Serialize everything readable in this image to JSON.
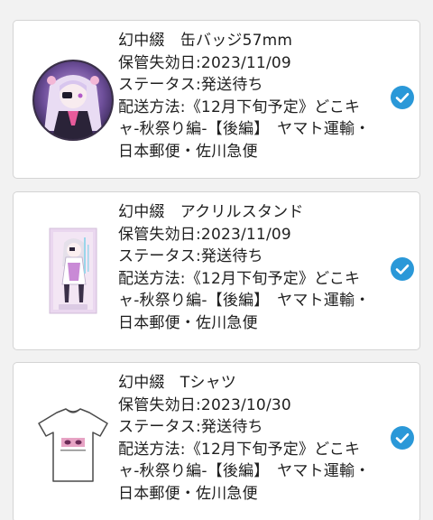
{
  "items": [
    {
      "name": "幻中綴　缶バッジ57mm",
      "expiry": "保管失効日:2023/11/09",
      "status": "ステータス:発送待ち",
      "shipping_lines": [
        "配送方法:《12月下旬予定》どこキ",
        "ャ-秋祭り編-【後編】　ヤマト運輸・",
        "日本郵便・佐川急便"
      ],
      "thumbnail": "can-badge-illustration",
      "checked": true
    },
    {
      "name": "幻中綴　アクリルスタンド",
      "expiry": "保管失効日:2023/11/09",
      "status": "ステータス:発送待ち",
      "shipping_lines": [
        "配送方法:《12月下旬予定》どこキ",
        "ャ-秋祭り編-【後編】　ヤマト運輸・",
        "日本郵便・佐川急便"
      ],
      "thumbnail": "acrylic-stand-illustration",
      "checked": true
    },
    {
      "name": "幻中綴　Tシャツ",
      "expiry": "保管失効日:2023/10/30",
      "status": "ステータス:発送待ち",
      "shipping_lines": [
        "配送方法:《12月下旬予定》どこキ",
        "ャ-秋祭り編-【後編】　ヤマト運輸・",
        "日本郵便・佐川急便"
      ],
      "thumbnail": "tshirt-illustration",
      "checked": true
    }
  ],
  "colors": {
    "check": "#2a98d8",
    "card_border": "#d4d4d4",
    "background": "#f2f2f2",
    "text": "#1f1f1f"
  }
}
